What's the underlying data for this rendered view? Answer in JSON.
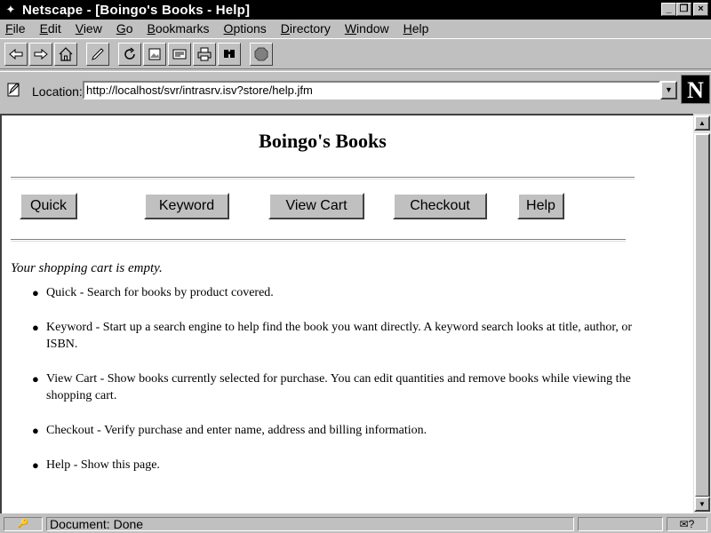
{
  "window": {
    "title": "Netscape - [Boingo's Books - Help]",
    "controls": {
      "minimize": "_",
      "restore": "❐",
      "close": "×"
    }
  },
  "menu": [
    {
      "label": "File",
      "accel": "F"
    },
    {
      "label": "Edit",
      "accel": "E"
    },
    {
      "label": "View",
      "accel": "V"
    },
    {
      "label": "Go",
      "accel": "G"
    },
    {
      "label": "Bookmarks",
      "accel": "B"
    },
    {
      "label": "Options",
      "accel": "O"
    },
    {
      "label": "Directory",
      "accel": "D"
    },
    {
      "label": "Window",
      "accel": "W"
    },
    {
      "label": "Help",
      "accel": "H"
    }
  ],
  "toolbar": {
    "icons": [
      "back-icon",
      "forward-icon",
      "home-icon",
      "edit-icon",
      "reload-icon",
      "images-icon",
      "open-icon",
      "print-icon",
      "find-icon",
      "stop-icon"
    ]
  },
  "location": {
    "label": "Location:",
    "url": "http://localhost/svr/intrasrv.isv?store/help.jfm",
    "logo": "N"
  },
  "page": {
    "title": "Boingo's Books",
    "nav": [
      {
        "label": "Quick"
      },
      {
        "label": "Keyword"
      },
      {
        "label": "View Cart"
      },
      {
        "label": "Checkout"
      },
      {
        "label": "Help"
      }
    ],
    "cart_message": "Your shopping cart is empty.",
    "help_items": [
      "Quick - Search for books by product covered.",
      "Keyword - Start up a search engine to help find the book you want directly. A keyword search looks at title, author, or ISBN.",
      "View Cart - Show books currently selected for purchase. You can edit quantities and remove books while viewing the shopping cart.",
      "Checkout - Verify purchase and enter name, address and billing information.",
      "Help - Show this page."
    ]
  },
  "status": {
    "text": "Document: Done",
    "security": "🔑",
    "mail": "✉?"
  },
  "scrollbar": {
    "up": "▲",
    "down": "▼"
  }
}
